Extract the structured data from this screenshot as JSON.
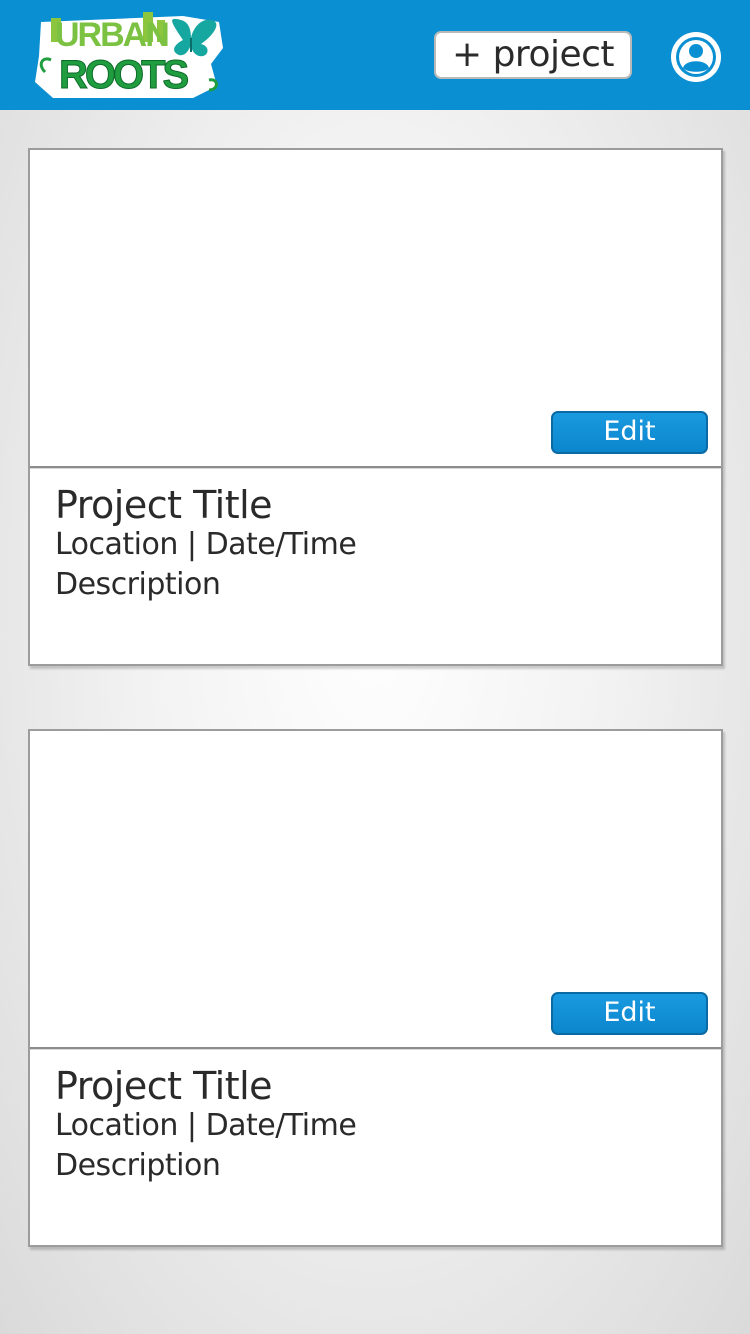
{
  "header": {
    "logo_line1": "URBAN",
    "logo_line2": "ROOTS",
    "add_project_label": "+ project",
    "profile_icon": "user-circle-icon",
    "color": "#0a8fd2"
  },
  "projects": [
    {
      "edit_label": "Edit",
      "title": "Project Title",
      "meta": "Location | Date/Time",
      "description": "Description"
    },
    {
      "edit_label": "Edit",
      "title": "Project Title",
      "meta": "Location | Date/Time",
      "description": "Description"
    }
  ],
  "colors": {
    "accent": "#0a8fd2",
    "logo_green": "#1f9d3f",
    "logo_lime": "#7cc242",
    "logo_teal": "#15a7a0"
  }
}
